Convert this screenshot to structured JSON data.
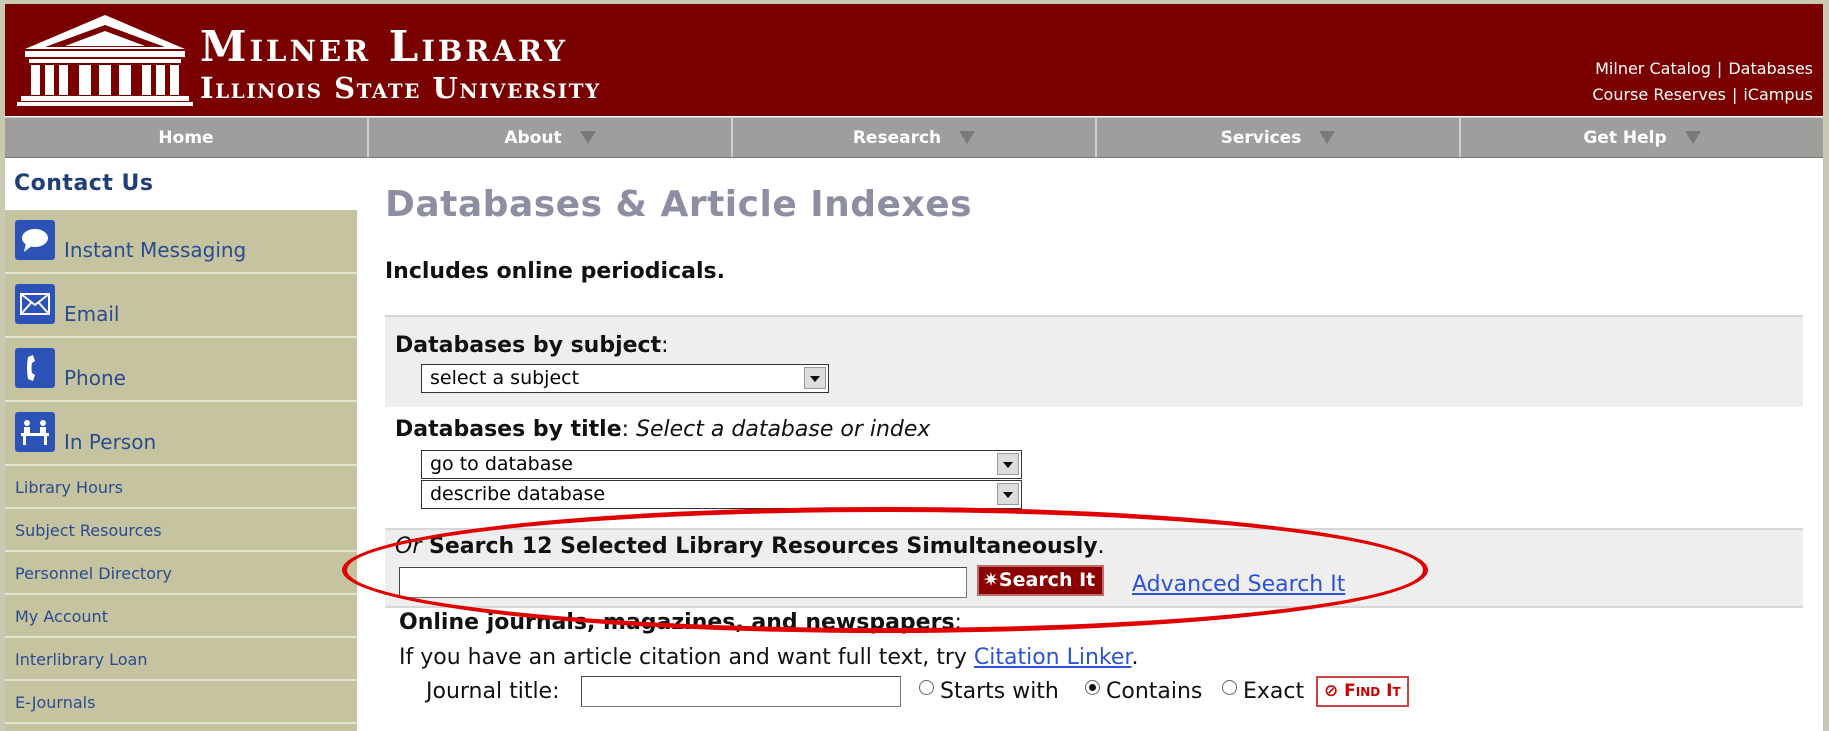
{
  "header": {
    "title_line1": "Milner Library",
    "title_line2": "Illinois State University",
    "links_row1": [
      "Milner Catalog",
      "Databases"
    ],
    "links_row2": [
      "Course Reserves",
      "iCampus"
    ],
    "separator": "|",
    "banner_color": "#7a0000"
  },
  "nav": {
    "items": [
      {
        "label": "Home",
        "has_arrow": false
      },
      {
        "label": "About",
        "has_arrow": true
      },
      {
        "label": "Research",
        "has_arrow": true
      },
      {
        "label": "Services",
        "has_arrow": true
      },
      {
        "label": "Get Help",
        "has_arrow": true
      }
    ]
  },
  "sidebar": {
    "heading": "Contact Us",
    "contact_items": [
      {
        "label": "Instant Messaging",
        "icon": "chat-bubble-icon"
      },
      {
        "label": "Email",
        "icon": "envelope-icon"
      },
      {
        "label": "Phone",
        "icon": "phone-icon"
      },
      {
        "label": "In Person",
        "icon": "person-desk-icon"
      }
    ],
    "links": [
      "Library Hours",
      "Subject Resources",
      "Personnel Directory",
      "My Account",
      "Interlibrary Loan",
      "E-Journals"
    ]
  },
  "main": {
    "title": "Databases & Article Indexes",
    "intro": "Includes online periodicals.",
    "by_subject": {
      "label": "Databases by subject",
      "colon": ":",
      "select_value": "select a subject"
    },
    "by_title": {
      "label": "Databases by title",
      "colon": ": ",
      "hint": "Select a database or index",
      "select1": "go to database",
      "select2": "describe database"
    },
    "search": {
      "or": "Or",
      "label": " Search 12 Selected Library Resources Simultaneously",
      "period": ".",
      "input_value": "",
      "button": "Search It",
      "advanced_link": "Advanced Search It"
    },
    "journals": {
      "label": "Online journals, magazines, and newspapers",
      "colon": ":",
      "citation_text": "If you have an article citation and want full text, try ",
      "citation_link": "Citation Linker",
      "citation_end": ".",
      "journal_label": "Journal title:",
      "journal_value": "",
      "radio_options": [
        {
          "label": "Starts with",
          "checked": false
        },
        {
          "label": "Contains",
          "checked": true
        },
        {
          "label": "Exact",
          "checked": false
        }
      ],
      "findit": "Find It"
    }
  },
  "annotation": {
    "color": "#e00000"
  }
}
